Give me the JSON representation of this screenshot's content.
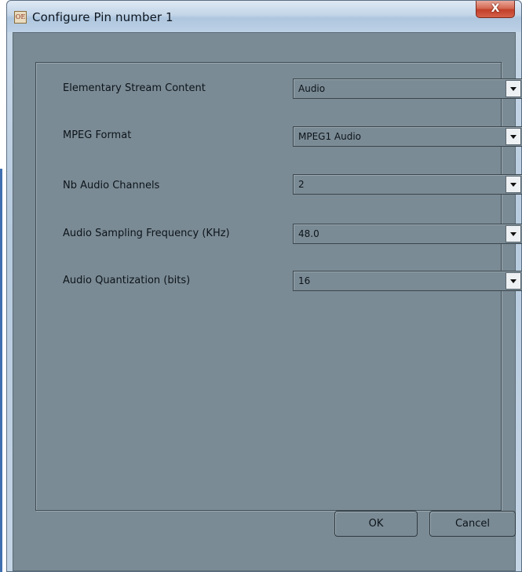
{
  "window": {
    "title": "Configure Pin number 1",
    "close_label": "X",
    "app_icon_glyph": "OE"
  },
  "form": {
    "rows": [
      {
        "label": "Elementary Stream Content",
        "value": "Audio"
      },
      {
        "label": "MPEG Format",
        "value": "MPEG1 Audio"
      },
      {
        "label": "Nb Audio Channels",
        "value": "2"
      },
      {
        "label": "Audio Sampling Frequency (KHz)",
        "value": "48.0"
      },
      {
        "label": "Audio Quantization (bits)",
        "value": "16"
      }
    ]
  },
  "buttons": {
    "ok_label": "OK",
    "cancel_label": "Cancel"
  },
  "colors": {
    "client_bg": "#7b8b95",
    "close_red": "#c2402a",
    "titlebar": "#c3d5e8"
  }
}
